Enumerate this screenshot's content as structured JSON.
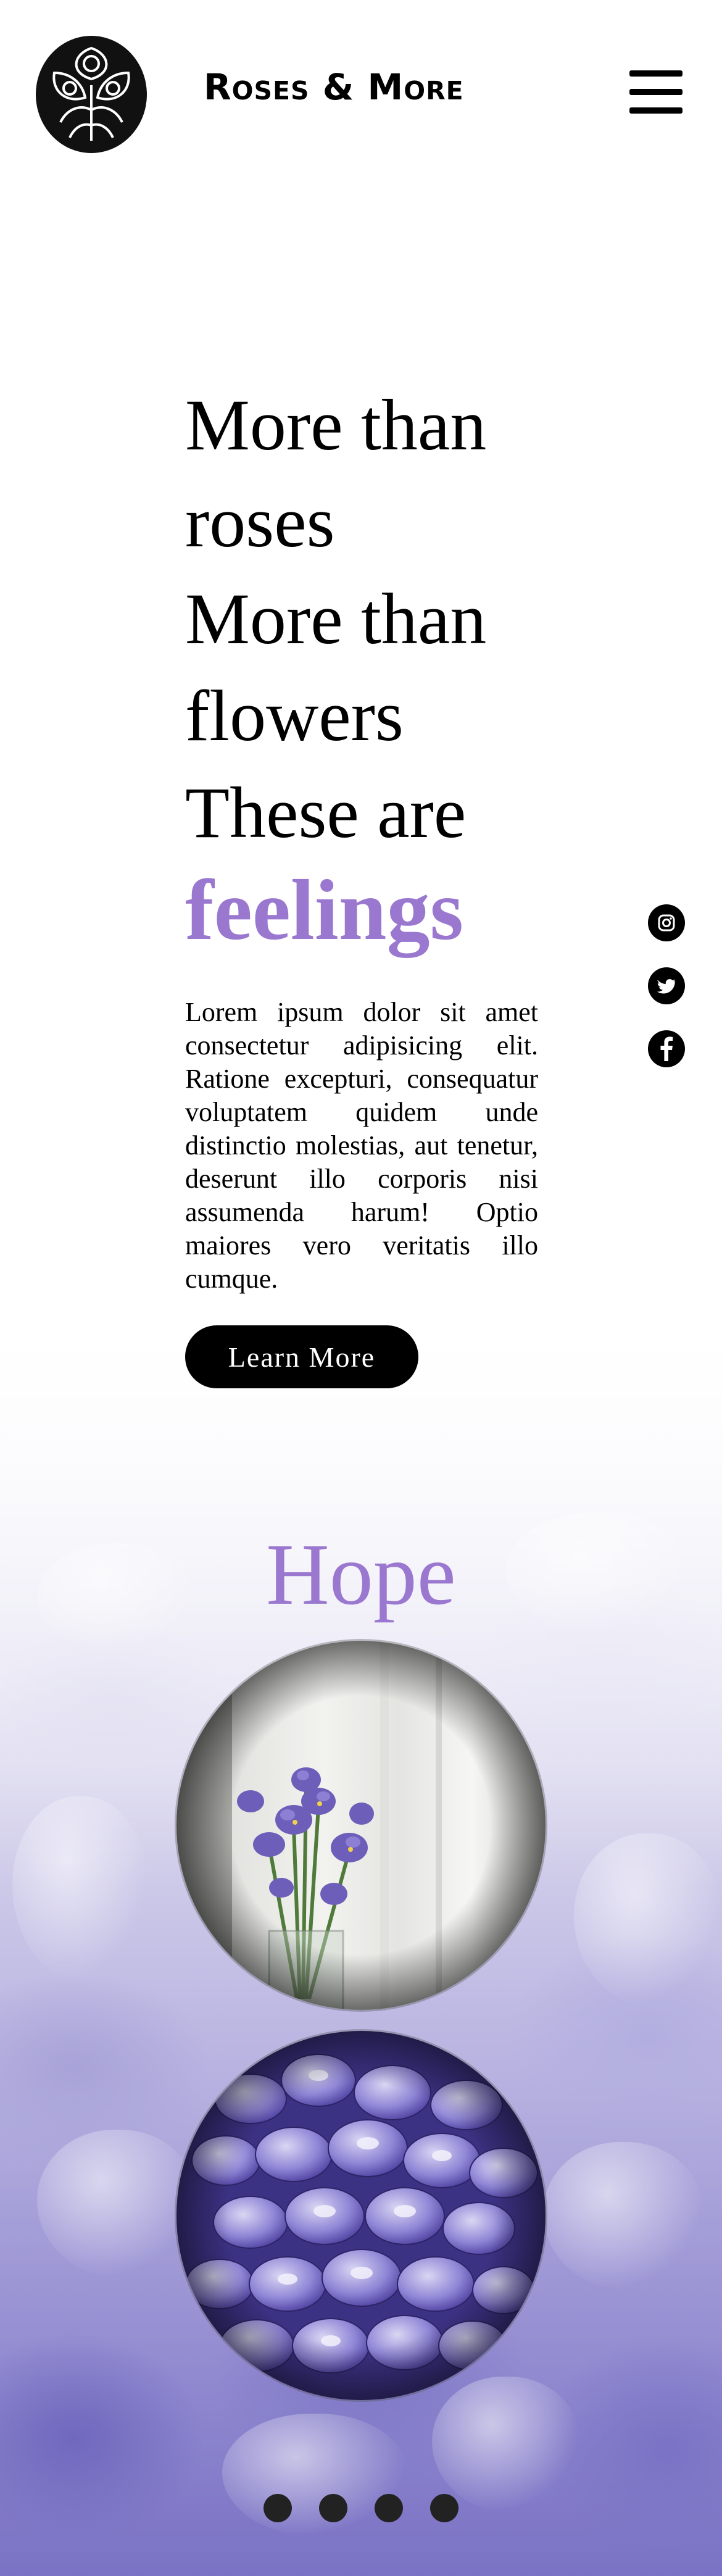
{
  "header": {
    "brand": "Roses & More",
    "logo_icon": "rose-emblem-icon",
    "menu_icon": "hamburger-menu-icon"
  },
  "hero": {
    "lines": [
      "More than",
      "roses",
      "More than",
      "flowers",
      "These are"
    ],
    "accent": "feelings",
    "body": "Lorem ipsum dolor sit amet consectetur adipisicing elit. Ratione excepturi, consequatur voluptatem quidem unde distinctio molestias, aut tenetur, deserunt illo corporis nisi assumenda harum! Optio maiores vero veritatis illo cumque.",
    "cta_label": "Learn More"
  },
  "social": [
    {
      "icon": "instagram-icon"
    },
    {
      "icon": "twitter-icon"
    },
    {
      "icon": "facebook-icon"
    }
  ],
  "hope": {
    "title": "Hope",
    "images": [
      "iris-vase-image",
      "wisteria-cluster-image"
    ]
  },
  "carousel": {
    "dot_count": 4
  },
  "colors": {
    "accent": "#9b78cf",
    "dark": "#000000",
    "lavender": "#8f88cf"
  }
}
